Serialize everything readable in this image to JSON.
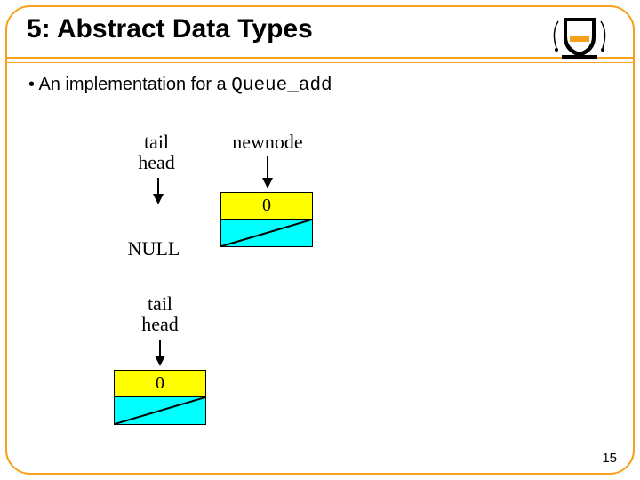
{
  "title": "5: Abstract Data Types",
  "bullet_prefix": "• An implementation for a ",
  "bullet_code": "Queue_add",
  "labels": {
    "tail": "tail",
    "head": "head",
    "newnode": "newnode",
    "null": "NULL"
  },
  "node1": {
    "value": "0"
  },
  "node2": {
    "value": "0"
  },
  "page_number": "15"
}
